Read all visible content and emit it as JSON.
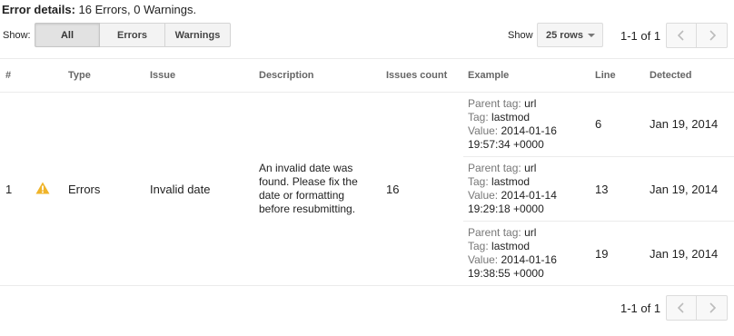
{
  "summary": {
    "label": "Error details:",
    "text": "16 Errors, 0 Warnings."
  },
  "filter": {
    "label": "Show:",
    "options": [
      "All",
      "Errors",
      "Warnings"
    ],
    "selected": "All"
  },
  "page_size": {
    "label": "Show",
    "value": "25 rows"
  },
  "pagination": {
    "top_text": "1-1 of 1",
    "bottom_text": "1-1 of 1"
  },
  "columns": [
    "#",
    "Type",
    "Issue",
    "Description",
    "Issues count",
    "Example",
    "Line",
    "Detected"
  ],
  "issue": {
    "index": "1",
    "type": "Errors",
    "issue": "Invalid date",
    "description_lines": [
      "An invalid date was",
      "found. Please fix the",
      "date or formatting",
      "before resubmitting."
    ],
    "count": "16",
    "examples": [
      {
        "parent_key": "Parent tag:",
        "parent": "url",
        "tag_key": "Tag:",
        "tag": "lastmod",
        "value_key": "Value:",
        "value": "2014-01-16",
        "value2": "19:57:34 +0000",
        "line": "6",
        "detected": "Jan 19, 2014"
      },
      {
        "parent_key": "Parent tag:",
        "parent": "url",
        "tag_key": "Tag:",
        "tag": "lastmod",
        "value_key": "Value:",
        "value": "2014-01-14",
        "value2": "19:29:18 +0000",
        "line": "13",
        "detected": "Jan 19, 2014"
      },
      {
        "parent_key": "Parent tag:",
        "parent": "url",
        "tag_key": "Tag:",
        "tag": "lastmod",
        "value_key": "Value:",
        "value": "2014-01-16",
        "value2": "19:38:55 +0000",
        "line": "19",
        "detected": "Jan 19, 2014"
      }
    ]
  },
  "icons": {
    "type_icon": "warning-icon",
    "prev": "chevron-left-icon",
    "next": "chevron-right-icon",
    "dropdown": "caret-down-icon"
  },
  "colors": {
    "warning": "#f0b429",
    "muted": "#777777",
    "border": "#ebebeb"
  }
}
